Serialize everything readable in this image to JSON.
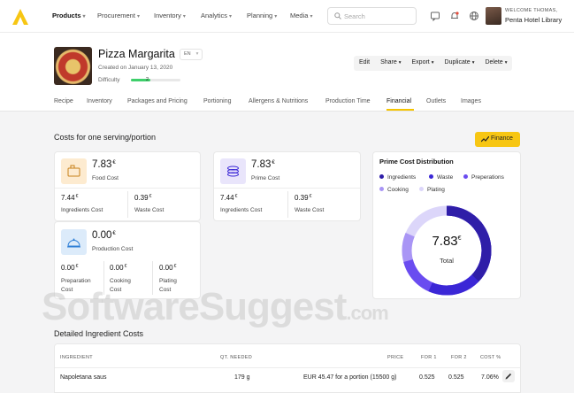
{
  "nav": {
    "items": [
      {
        "label": "Products",
        "active": true
      },
      {
        "label": "Procurement",
        "active": false
      },
      {
        "label": "Inventory",
        "active": false
      },
      {
        "label": "Analytics",
        "active": false
      },
      {
        "label": "Planning",
        "active": false
      },
      {
        "label": "Media",
        "active": false
      }
    ],
    "search_placeholder": "Search",
    "welcome": "WELCOME THOMAS,",
    "org": "Penta Hotel Library"
  },
  "header": {
    "title": "Pizza Margarita",
    "lang": "EN",
    "created": "Created on January 13, 2020",
    "difficulty_label": "Difficulty",
    "difficulty_value": "2",
    "actions": [
      "Edit",
      "Share",
      "Export",
      "Duplicate",
      "Delete"
    ],
    "tabs": [
      "Recipe",
      "Inventory",
      "Packages and Pricing",
      "Portioning",
      "Allergens & Nutritions",
      "Production Time",
      "Financial",
      "Outlets",
      "Images"
    ],
    "active_tab": "Financial"
  },
  "costs": {
    "section_title": "Costs for one serving/portion",
    "finance_button": "Finance",
    "currency": "€",
    "food": {
      "value": "7.83",
      "label": "Food Cost",
      "ingredients_value": "7.44",
      "ingredients_label": "Ingredients Cost",
      "waste_value": "0.39",
      "waste_label": "Waste Cost"
    },
    "prime": {
      "value": "7.83",
      "label": "Prime Cost",
      "ingredients_value": "7.44",
      "ingredients_label": "Ingredients Cost",
      "waste_value": "0.39",
      "waste_label": "Waste Cost"
    },
    "production": {
      "value": "0.00",
      "label": "Production Cost",
      "prep_value": "0.00",
      "prep_label_1": "Preparation",
      "prep_label_2": "Cost",
      "cook_value": "0.00",
      "cook_label_1": "Cooking",
      "cook_label_2": "Cost",
      "plate_value": "0.00",
      "plate_label_1": "Plating",
      "plate_label_2": "Cost"
    }
  },
  "distribution": {
    "title": "Prime Cost Distribution",
    "legend": [
      {
        "label": "Ingredients",
        "color": "#2f1ea8"
      },
      {
        "label": "Waste",
        "color": "#3b27d6"
      },
      {
        "label": "Preperations",
        "color": "#6a4cf0"
      },
      {
        "label": "Cooking",
        "color": "#a995f5"
      },
      {
        "label": "Plating",
        "color": "#dcd6fa"
      }
    ],
    "total_value": "7.83",
    "total_label": "Total"
  },
  "details": {
    "title": "Detailed Ingredient Costs",
    "columns": [
      "INGREDIENT",
      "QT. NEEDED",
      "PRICE",
      "FOR 1",
      "FOR 2",
      "COST %"
    ],
    "rows": [
      {
        "ingredient": "Napoletana saus",
        "qty": "179 g",
        "price": "EUR 45.47 for a portion (15500 g)",
        "for1": "0.525",
        "for2": "0.525",
        "cost_pct": "7.06%"
      }
    ]
  },
  "watermark": {
    "main": "SoftwareSuggest",
    "suffix": ".com"
  },
  "colors": {
    "accent": "#f7c613",
    "primary": "#3b27d6"
  }
}
